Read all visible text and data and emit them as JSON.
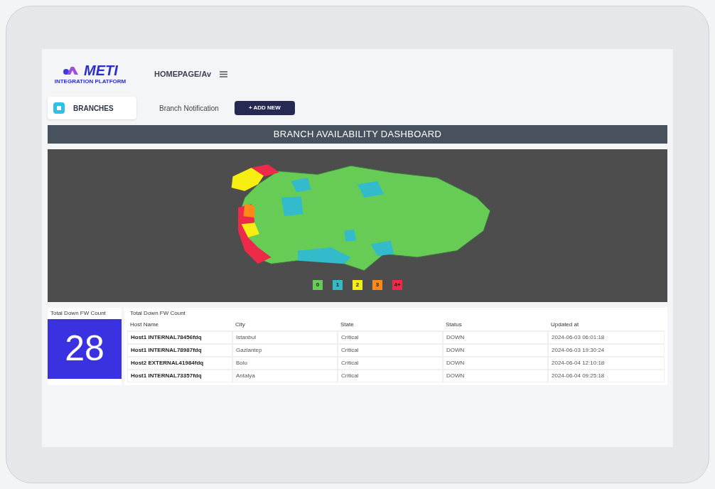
{
  "logo": {
    "name": "METI",
    "subtitle": "INTEGRATION PLATFORM"
  },
  "breadcrumb": "HOMEPAGE/Av",
  "sidebar": {
    "items": [
      {
        "label": "BRANCHES",
        "selected": true
      }
    ]
  },
  "section_title": "Branch Notification",
  "add_button": "+ ADD NEW",
  "dashboard_title": "BRANCH AVAILABILITY DASHBOARD",
  "legend": [
    {
      "label": "0",
      "color": "#66cc55"
    },
    {
      "label": "1",
      "color": "#33bbcc"
    },
    {
      "label": "2",
      "color": "#f5ee10"
    },
    {
      "label": "3",
      "color": "#ff8a1a"
    },
    {
      "label": "4+",
      "color": "#ee2a4a"
    }
  ],
  "count_card": {
    "title": "Total Down FW Count",
    "value": "28"
  },
  "table": {
    "title": "Total Down FW Count",
    "columns": [
      "Host Name",
      "City",
      "State",
      "Status",
      "Updated at"
    ],
    "rows": [
      [
        "Host1 INTERNAL78456fdq",
        "Istanbul",
        "Critical",
        "DOWN",
        "2024-06-03 06:01:18"
      ],
      [
        "Host1 INTERNAL78987fdq",
        "Gaziantep",
        "Critical",
        "DOWN",
        "2024-06-03 19:30:24"
      ],
      [
        "Host2 EXTERNAL41984fdq",
        "Bolu",
        "Critical",
        "DOWN",
        "2024-06-04 12:10:18"
      ],
      [
        "Host1 INTERNAL73357fdq",
        "Antalya",
        "Critical",
        "DOWN",
        "2024-06-04 09:25:18"
      ]
    ]
  }
}
